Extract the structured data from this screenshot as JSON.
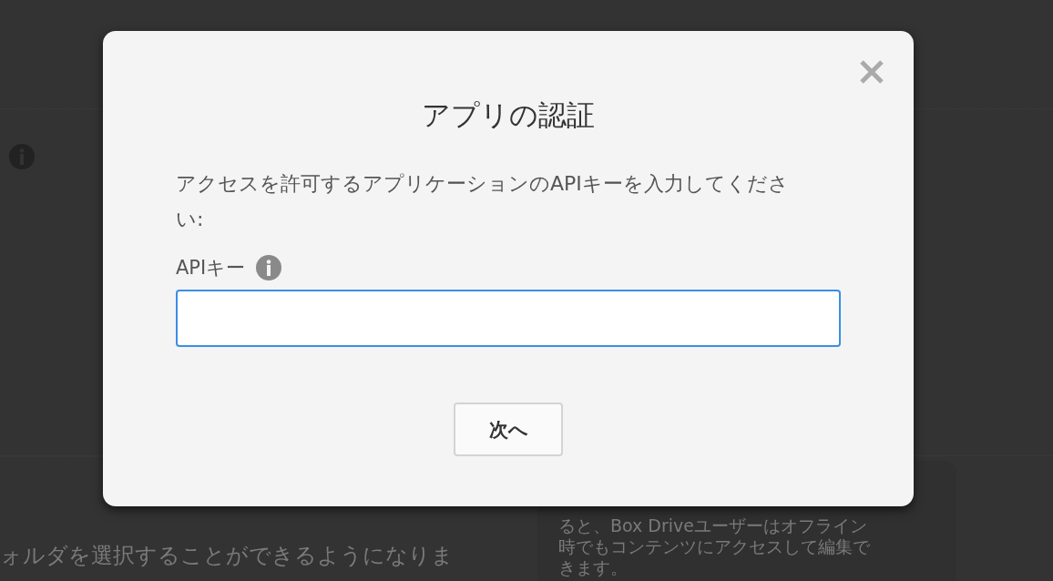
{
  "background": {
    "left_text": "ォルダを選択することができるようになりま",
    "hint_lines": [
      "ると、Box Driveユーザーはオフライン",
      "時でもコンテンツにアクセスして編集で",
      "きます。"
    ]
  },
  "dialog": {
    "title": "アプリの認証",
    "description": "アクセスを許可するアプリケーションのAPIキーを入力してください:",
    "field_label": "APIキー",
    "api_key_field": {
      "focused": true
    },
    "button": "次へ"
  }
}
